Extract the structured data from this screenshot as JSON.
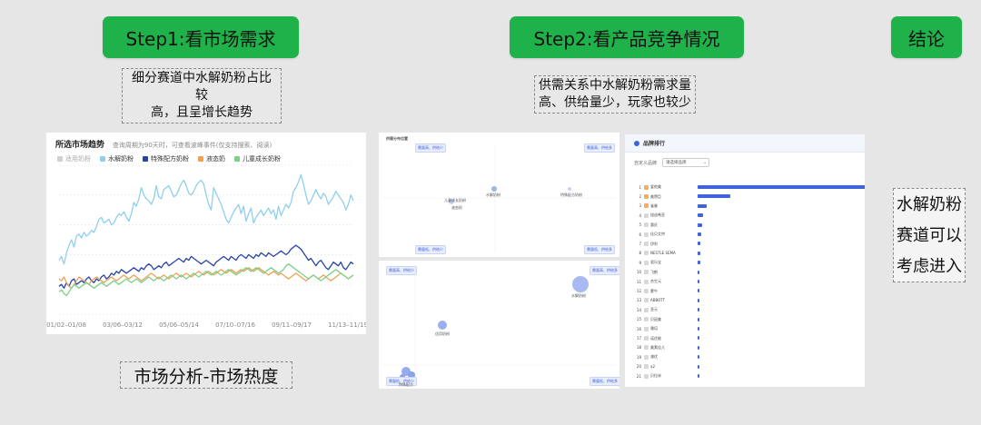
{
  "steps": {
    "step1": "Step1:看市场需求",
    "step2": "Step2:看产品竞争情况",
    "conclusion": "结论"
  },
  "notes": {
    "demand_line1": "细分赛道中水解奶粉占比较",
    "demand_line2": "高，且呈增长趋势",
    "supply_line1": "供需关系中水解奶粉需求量",
    "supply_line2": "高、供给量少，玩家也较少"
  },
  "conclusion_text": {
    "line1": "水解奶粉",
    "line2": "赛道可以",
    "line3": "考虑进入"
  },
  "caption": "市场分析-市场热度",
  "trend": {
    "title": "所选市场趋势",
    "subtitle": "查询周期为90天时，可查看波峰事件(仅支持搜索、阅读)",
    "legend": [
      {
        "label": "适用奶粉",
        "color": "#cfcfcf",
        "muted": true
      },
      {
        "label": "水解奶粉",
        "color": "#8fd0ee"
      },
      {
        "label": "特殊配方奶粉",
        "color": "#2844a6"
      },
      {
        "label": "液态奶",
        "color": "#f0a050"
      },
      {
        "label": "儿童成长奶粉",
        "color": "#7cd08c"
      }
    ]
  },
  "chart_data": {
    "type": "line",
    "title": "所选市场趋势",
    "x_tick_labels": [
      "01/02–01/08",
      "03/06–03/12",
      "05/06–05/14",
      "07/10–07/16",
      "09/11–09/17",
      "11/13–11/19"
    ],
    "series": [
      {
        "name": "水解奶粉",
        "color": "#8fd0ee",
        "values": [
          58,
          62,
          54,
          66,
          74,
          80,
          72,
          84,
          86,
          82,
          88,
          84,
          86,
          90,
          88,
          94,
          102,
          104,
          98,
          100,
          102,
          96,
          98,
          104,
          108,
          106,
          110,
          104,
          100,
          108,
          120,
          116,
          124,
          136,
          128,
          124,
          122,
          118,
          124,
          138,
          126,
          124,
          134,
          136,
          138,
          132,
          126,
          128,
          134,
          140,
          144,
          138,
          130,
          128,
          132,
          138,
          142,
          144,
          140,
          128,
          118,
          112,
          136,
          130,
          124,
          118,
          110,
          102,
          98,
          104,
          110,
          114,
          118,
          108,
          116,
          100,
          108,
          114,
          98,
          104,
          108,
          112,
          106,
          110,
          114,
          108,
          112,
          102,
          116,
          106,
          112,
          118,
          114,
          120,
          132,
          136,
          142,
          150,
          140,
          128,
          118,
          122,
          128,
          134,
          128,
          124,
          130,
          126,
          118,
          122,
          126,
          132,
          128,
          124,
          120,
          112,
          118,
          128,
          122
        ]
      },
      {
        "name": "特殊配方奶粉",
        "color": "#2844a6",
        "values": [
          30,
          32,
          28,
          34,
          30,
          36,
          38,
          32,
          34,
          36,
          34,
          38,
          40,
          36,
          34,
          38,
          36,
          40,
          42,
          38,
          40,
          44,
          42,
          46,
          44,
          48,
          46,
          44,
          46,
          48,
          50,
          48,
          46,
          50,
          48,
          52,
          54,
          52,
          48,
          50,
          52,
          50,
          54,
          56,
          52,
          54,
          56,
          58,
          60,
          58,
          56,
          60,
          58,
          62,
          60,
          58,
          56,
          54,
          56,
          58,
          56,
          54,
          52,
          56,
          58,
          60,
          62,
          60,
          58,
          62,
          60,
          58,
          62,
          64,
          62,
          60,
          64,
          62,
          60,
          64,
          62,
          66,
          64,
          62,
          66,
          64,
          62,
          64,
          66,
          68,
          66,
          64,
          66,
          70,
          72,
          74,
          72,
          70,
          66,
          62,
          58,
          60,
          56,
          52,
          56,
          58,
          54,
          50,
          48,
          52,
          56,
          54,
          52,
          56,
          50,
          48,
          52,
          56,
          54
        ]
      },
      {
        "name": "液态奶",
        "color": "#f0a050",
        "values": [
          38,
          36,
          40,
          34,
          30,
          28,
          32,
          36,
          40,
          38,
          36,
          34,
          32,
          36,
          38,
          40,
          38,
          36,
          34,
          36,
          38,
          40,
          38,
          36,
          38,
          40,
          42,
          40,
          38,
          40,
          42,
          40,
          38,
          36,
          38,
          40,
          42,
          44,
          42,
          40,
          38,
          40,
          42,
          40,
          38,
          40,
          42,
          44,
          42,
          40,
          42,
          44,
          42,
          40,
          42,
          44,
          46,
          44,
          42,
          44,
          46,
          44,
          42,
          44,
          46,
          48,
          46,
          44,
          46,
          48,
          46,
          44,
          46,
          48,
          46,
          48,
          50,
          48,
          46,
          48,
          50,
          48,
          46,
          44,
          42,
          44,
          46,
          44,
          42,
          44,
          42,
          40,
          38,
          40,
          42,
          44,
          42,
          40,
          38,
          36,
          38,
          40,
          42,
          40,
          38,
          40,
          42,
          40,
          38,
          36,
          38,
          40,
          42,
          44,
          42,
          40,
          38,
          40,
          42
        ]
      },
      {
        "name": "儿童成长奶粉",
        "color": "#7cd08c",
        "values": [
          24,
          26,
          22,
          20,
          24,
          28,
          32,
          30,
          28,
          30,
          32,
          34,
          32,
          30,
          28,
          30,
          32,
          34,
          32,
          30,
          32,
          34,
          36,
          34,
          32,
          34,
          36,
          38,
          36,
          34,
          36,
          38,
          36,
          34,
          36,
          38,
          40,
          38,
          36,
          38,
          40,
          38,
          36,
          38,
          40,
          42,
          40,
          38,
          40,
          42,
          40,
          38,
          40,
          42,
          44,
          42,
          40,
          42,
          44,
          46,
          44,
          42,
          44,
          46,
          44,
          42,
          44,
          46,
          48,
          46,
          44,
          42,
          44,
          46,
          48,
          50,
          48,
          46,
          48,
          50,
          48,
          46,
          44,
          46,
          48,
          50,
          48,
          46,
          44,
          46,
          48,
          52,
          54,
          52,
          50,
          48,
          46,
          44,
          42,
          40,
          38,
          40,
          42,
          40,
          38,
          36,
          38,
          40,
          42,
          44,
          46,
          48,
          46,
          44,
          42,
          40,
          38,
          40,
          42
        ]
      }
    ],
    "ylim": [
      0,
      160
    ],
    "grid": true,
    "legend_position": "top-left"
  },
  "bubble_top": {
    "title": "供需分布位置",
    "labels": [
      "需量高、供给少",
      "需量高、供给多",
      "需量低、供给少",
      "需量低、供给多",
      "儿童成长奶粉",
      "液态奶",
      "水解奶粉",
      "特殊配方奶粉"
    ]
  },
  "bubble_bottom": {
    "labels": [
      "需量高、供给少",
      "需量高、供给多",
      "需量低、供给少",
      "需量低、供给多",
      "水解奶粉",
      "适用奶粉",
      "特殊配方"
    ]
  },
  "ranking": {
    "title": "品牌排行",
    "filter_label": "自定义品牌",
    "filter_placeholder": "请选择品牌",
    "rows": [
      {
        "rank": "1",
        "name": "爱他美",
        "value": 100
      },
      {
        "rank": "2",
        "name": "美赞臣",
        "value": 19
      },
      {
        "rank": "3",
        "name": "雀巢",
        "value": 5
      },
      {
        "rank": "4",
        "name": "纽迪希亚",
        "value": 3
      },
      {
        "rank": "5",
        "name": "惠氏",
        "value": 2.5
      },
      {
        "rank": "6",
        "name": "佳贝艾特",
        "value": 2.2
      },
      {
        "rank": "7",
        "name": "伊利",
        "value": 1.8
      },
      {
        "rank": "8",
        "name": "NESTLE SEMA",
        "value": 1.6
      },
      {
        "rank": "9",
        "name": "君乐宝",
        "value": 1.4
      },
      {
        "rank": "10",
        "name": "飞鹤",
        "value": 1.3
      },
      {
        "rank": "11",
        "name": "合生元",
        "value": 1.2
      },
      {
        "rank": "12",
        "name": "蒙牛",
        "value": 1.1
      },
      {
        "rank": "13",
        "name": "ABBOTT",
        "value": 1.0
      },
      {
        "rank": "14",
        "name": "圣元",
        "value": 0.9
      },
      {
        "rank": "15",
        "name": "贝因美",
        "value": 0.8
      },
      {
        "rank": "16",
        "name": "雅培",
        "value": 0.7
      },
      {
        "rank": "17",
        "name": "诺优能",
        "value": 0.6
      },
      {
        "rank": "18",
        "name": "美素佳儿",
        "value": 0.5
      },
      {
        "rank": "19",
        "name": "澳优",
        "value": 0.45
      },
      {
        "rank": "20",
        "name": "a2",
        "value": 0.4
      },
      {
        "rank": "21",
        "name": "贝拉米",
        "value": 0.35
      }
    ]
  }
}
